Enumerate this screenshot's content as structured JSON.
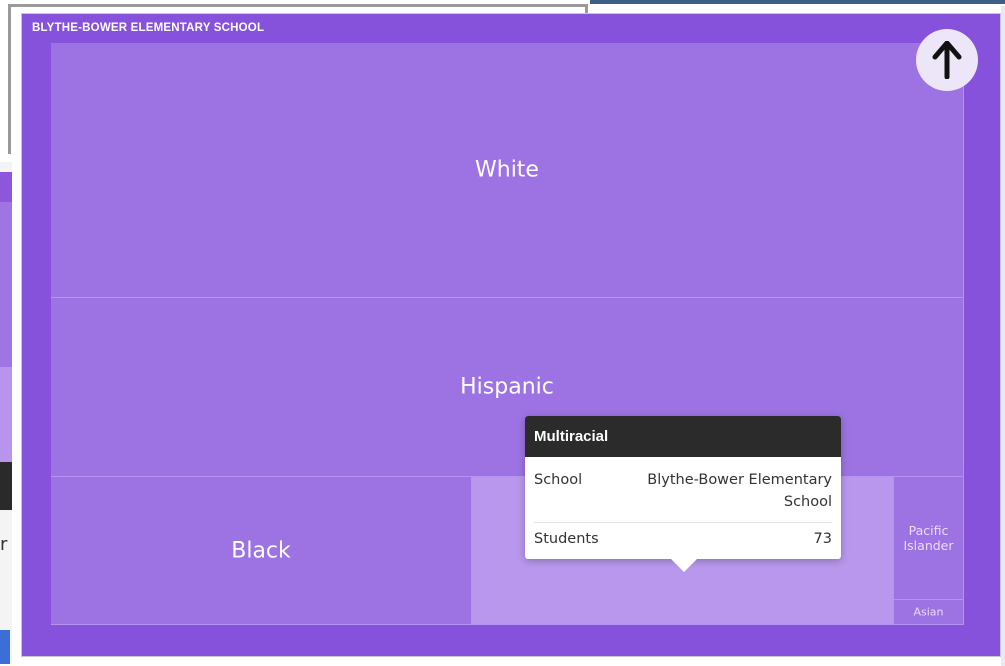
{
  "colors": {
    "frame": "#8651db",
    "cell": "#9d73e3",
    "cell_highlight": "#b897ec",
    "cell_border": "#b593ee",
    "tooltip_header": "#2b2b2b"
  },
  "chart_data": {
    "type": "treemap",
    "title": "BLYTHE-BOWER ELEMENTARY SCHOOL",
    "categories": [
      "White",
      "Hispanic",
      "Black",
      "Multiracial",
      "Pacific Islander",
      "Asian"
    ],
    "values": [
      250,
      175,
      105,
      73,
      10,
      2
    ],
    "highlighted": "Multiracial"
  },
  "up_button": {
    "icon": "arrow-up-icon"
  },
  "tooltip": {
    "title": "Multiracial",
    "rows": [
      {
        "label": "School",
        "value": "Blythe-Bower Elementary School"
      },
      {
        "label": "Students",
        "value": "73"
      }
    ]
  }
}
